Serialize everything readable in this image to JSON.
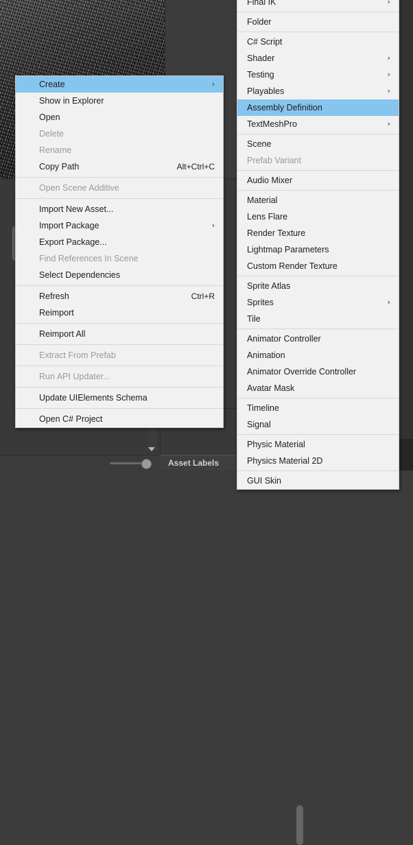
{
  "app": {
    "background_panel_color": "#3c3c3c",
    "highlight_color": "#86c5ee",
    "menu_background_color": "#f1f1f1",
    "disabled_text_color": "#9a9a9a"
  },
  "editor": {
    "asset_labels_label": "Asset Labels"
  },
  "context_menu": {
    "name": "project-asset-context-menu",
    "groups": [
      {
        "items": [
          {
            "label": "Create",
            "enabled": true,
            "highlighted": true,
            "submenu": true,
            "shortcut": ""
          },
          {
            "label": "Show in Explorer",
            "enabled": true,
            "highlighted": false,
            "submenu": false,
            "shortcut": ""
          },
          {
            "label": "Open",
            "enabled": true,
            "highlighted": false,
            "submenu": false,
            "shortcut": ""
          },
          {
            "label": "Delete",
            "enabled": false,
            "highlighted": false,
            "submenu": false,
            "shortcut": ""
          },
          {
            "label": "Rename",
            "enabled": false,
            "highlighted": false,
            "submenu": false,
            "shortcut": ""
          },
          {
            "label": "Copy Path",
            "enabled": true,
            "highlighted": false,
            "submenu": false,
            "shortcut": "Alt+Ctrl+C"
          }
        ]
      },
      {
        "items": [
          {
            "label": "Open Scene Additive",
            "enabled": false,
            "highlighted": false,
            "submenu": false,
            "shortcut": ""
          }
        ]
      },
      {
        "items": [
          {
            "label": "Import New Asset...",
            "enabled": true,
            "highlighted": false,
            "submenu": false,
            "shortcut": ""
          },
          {
            "label": "Import Package",
            "enabled": true,
            "highlighted": false,
            "submenu": true,
            "shortcut": ""
          },
          {
            "label": "Export Package...",
            "enabled": true,
            "highlighted": false,
            "submenu": false,
            "shortcut": ""
          },
          {
            "label": "Find References In Scene",
            "enabled": false,
            "highlighted": false,
            "submenu": false,
            "shortcut": ""
          },
          {
            "label": "Select Dependencies",
            "enabled": true,
            "highlighted": false,
            "submenu": false,
            "shortcut": ""
          }
        ]
      },
      {
        "items": [
          {
            "label": "Refresh",
            "enabled": true,
            "highlighted": false,
            "submenu": false,
            "shortcut": "Ctrl+R"
          },
          {
            "label": "Reimport",
            "enabled": true,
            "highlighted": false,
            "submenu": false,
            "shortcut": ""
          }
        ]
      },
      {
        "items": [
          {
            "label": "Reimport All",
            "enabled": true,
            "highlighted": false,
            "submenu": false,
            "shortcut": ""
          }
        ]
      },
      {
        "items": [
          {
            "label": "Extract From Prefab",
            "enabled": false,
            "highlighted": false,
            "submenu": false,
            "shortcut": ""
          }
        ]
      },
      {
        "items": [
          {
            "label": "Run API Updater...",
            "enabled": false,
            "highlighted": false,
            "submenu": false,
            "shortcut": ""
          }
        ]
      },
      {
        "items": [
          {
            "label": "Update UIElements Schema",
            "enabled": true,
            "highlighted": false,
            "submenu": false,
            "shortcut": ""
          }
        ]
      },
      {
        "items": [
          {
            "label": "Open C# Project",
            "enabled": true,
            "highlighted": false,
            "submenu": false,
            "shortcut": ""
          }
        ]
      }
    ]
  },
  "create_submenu": {
    "name": "create-submenu",
    "groups": [
      {
        "items": [
          {
            "label": "Final IK",
            "enabled": true,
            "highlighted": false,
            "submenu": true
          }
        ]
      },
      {
        "items": [
          {
            "label": "Folder",
            "enabled": true,
            "highlighted": false,
            "submenu": false
          }
        ]
      },
      {
        "items": [
          {
            "label": "C# Script",
            "enabled": true,
            "highlighted": false,
            "submenu": false
          },
          {
            "label": "Shader",
            "enabled": true,
            "highlighted": false,
            "submenu": true
          },
          {
            "label": "Testing",
            "enabled": true,
            "highlighted": false,
            "submenu": true
          },
          {
            "label": "Playables",
            "enabled": true,
            "highlighted": false,
            "submenu": true
          },
          {
            "label": "Assembly Definition",
            "enabled": true,
            "highlighted": true,
            "submenu": false
          },
          {
            "label": "TextMeshPro",
            "enabled": true,
            "highlighted": false,
            "submenu": true
          }
        ]
      },
      {
        "items": [
          {
            "label": "Scene",
            "enabled": true,
            "highlighted": false,
            "submenu": false
          },
          {
            "label": "Prefab Variant",
            "enabled": false,
            "highlighted": false,
            "submenu": false
          }
        ]
      },
      {
        "items": [
          {
            "label": "Audio Mixer",
            "enabled": true,
            "highlighted": false,
            "submenu": false
          }
        ]
      },
      {
        "items": [
          {
            "label": "Material",
            "enabled": true,
            "highlighted": false,
            "submenu": false
          },
          {
            "label": "Lens Flare",
            "enabled": true,
            "highlighted": false,
            "submenu": false
          },
          {
            "label": "Render Texture",
            "enabled": true,
            "highlighted": false,
            "submenu": false
          },
          {
            "label": "Lightmap Parameters",
            "enabled": true,
            "highlighted": false,
            "submenu": false
          },
          {
            "label": "Custom Render Texture",
            "enabled": true,
            "highlighted": false,
            "submenu": false
          }
        ]
      },
      {
        "items": [
          {
            "label": "Sprite Atlas",
            "enabled": true,
            "highlighted": false,
            "submenu": false
          },
          {
            "label": "Sprites",
            "enabled": true,
            "highlighted": false,
            "submenu": true
          },
          {
            "label": "Tile",
            "enabled": true,
            "highlighted": false,
            "submenu": false
          }
        ]
      },
      {
        "items": [
          {
            "label": "Animator Controller",
            "enabled": true,
            "highlighted": false,
            "submenu": false
          },
          {
            "label": "Animation",
            "enabled": true,
            "highlighted": false,
            "submenu": false
          },
          {
            "label": "Animator Override Controller",
            "enabled": true,
            "highlighted": false,
            "submenu": false
          },
          {
            "label": "Avatar Mask",
            "enabled": true,
            "highlighted": false,
            "submenu": false
          }
        ]
      },
      {
        "items": [
          {
            "label": "Timeline",
            "enabled": true,
            "highlighted": false,
            "submenu": false
          },
          {
            "label": "Signal",
            "enabled": true,
            "highlighted": false,
            "submenu": false
          }
        ]
      },
      {
        "items": [
          {
            "label": "Physic Material",
            "enabled": true,
            "highlighted": false,
            "submenu": false
          },
          {
            "label": "Physics Material 2D",
            "enabled": true,
            "highlighted": false,
            "submenu": false
          }
        ]
      },
      {
        "items": [
          {
            "label": "GUI Skin",
            "enabled": true,
            "highlighted": false,
            "submenu": false
          }
        ]
      }
    ]
  },
  "icons": {
    "submenu_chevron": "›",
    "scroll_down_arrow": "scroll-down-arrow-icon"
  }
}
